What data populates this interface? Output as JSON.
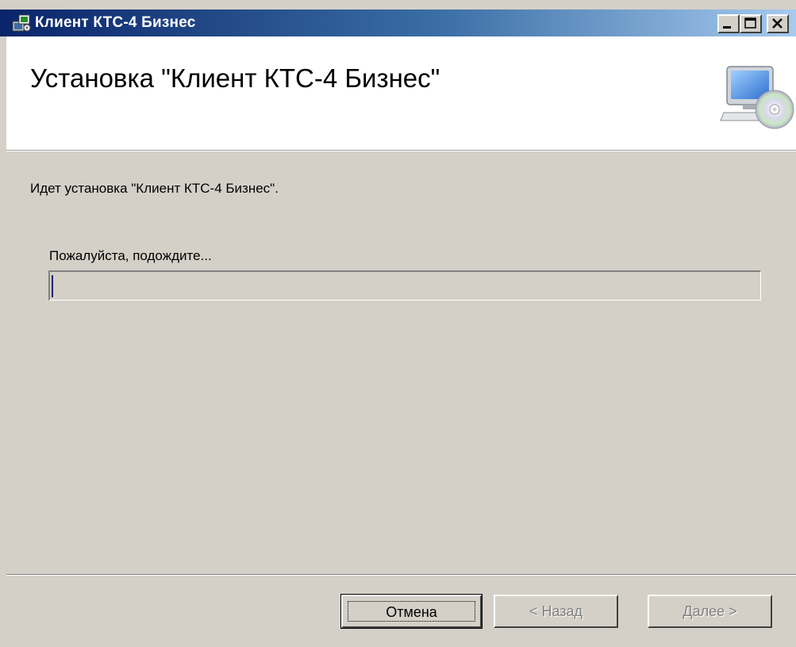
{
  "window": {
    "title": "Клиент КТС-4 Бизнес"
  },
  "banner": {
    "title": "Установка \"Клиент КТС-4 Бизнес\""
  },
  "content": {
    "status_text": "Идет установка \"Клиент КТС-4 Бизнес\".",
    "wait_label": "Пожалуйста, подождите...",
    "progress_fraction": 0.0
  },
  "buttons": {
    "cancel": "Отмена",
    "back": "< Назад",
    "next": "Далее >"
  },
  "icons": {
    "title_icon": "installer-package-icon",
    "banner_icon": "computer-cd-icon",
    "minimize": "minimize-icon",
    "maximize": "maximize-icon",
    "close": "close-icon"
  },
  "colors": {
    "titlebar_start": "#0a246a",
    "titlebar_end": "#a6caf0",
    "dialog_bg": "#d4d0c8",
    "progress_fill": "#0a246a"
  }
}
